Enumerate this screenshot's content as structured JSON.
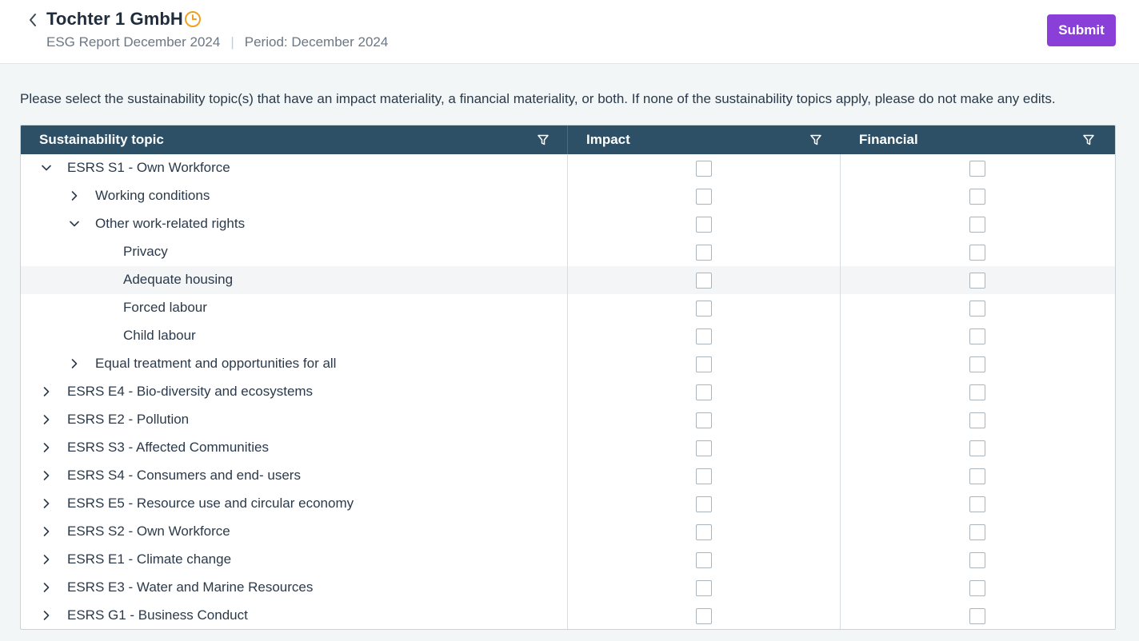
{
  "header": {
    "title": "Tochter 1 GmbH",
    "report": "ESG Report December 2024",
    "separator": "|",
    "period": "Period: December 2024",
    "submit_label": "Submit"
  },
  "instructions": "Please select the sustainability topic(s) that have an impact materiality, a financial materiality, or both. If none of the sustainability topics apply, please do not make any edits.",
  "grid": {
    "columns": [
      "Sustainability topic",
      "Impact",
      "Financial"
    ],
    "rows": [
      {
        "label": "ESRS S1 - Own Workforce",
        "level": 0,
        "expander": "expanded",
        "impact": false,
        "financial": false
      },
      {
        "label": "Working conditions",
        "level": 1,
        "expander": "collapsed",
        "impact": false,
        "financial": false
      },
      {
        "label": "Other work-related rights",
        "level": 1,
        "expander": "expanded",
        "impact": false,
        "financial": false
      },
      {
        "label": "Privacy",
        "level": 2,
        "expander": "none",
        "impact": false,
        "financial": false
      },
      {
        "label": "Adequate housing",
        "level": 2,
        "expander": "none",
        "impact": false,
        "financial": false,
        "highlighted": true
      },
      {
        "label": "Forced labour",
        "level": 2,
        "expander": "none",
        "impact": false,
        "financial": false
      },
      {
        "label": "Child labour",
        "level": 2,
        "expander": "none",
        "impact": false,
        "financial": false
      },
      {
        "label": "Equal treatment and opportunities for all",
        "level": 1,
        "expander": "collapsed",
        "impact": false,
        "financial": false
      },
      {
        "label": "ESRS E4 - Bio-diversity and ecosystems",
        "level": 0,
        "expander": "collapsed",
        "impact": false,
        "financial": false
      },
      {
        "label": "ESRS E2 - Pollution",
        "level": 0,
        "expander": "collapsed",
        "impact": false,
        "financial": false
      },
      {
        "label": "ESRS S3 - Affected Communities",
        "level": 0,
        "expander": "collapsed",
        "impact": false,
        "financial": false
      },
      {
        "label": "ESRS S4 - Consumers and end- users",
        "level": 0,
        "expander": "collapsed",
        "impact": false,
        "financial": false
      },
      {
        "label": "ESRS E5 - Resource use and circular economy",
        "level": 0,
        "expander": "collapsed",
        "impact": false,
        "financial": false
      },
      {
        "label": "ESRS S2 - Own Workforce",
        "level": 0,
        "expander": "collapsed",
        "impact": false,
        "financial": false
      },
      {
        "label": "ESRS E1 - Climate change",
        "level": 0,
        "expander": "collapsed",
        "impact": false,
        "financial": false
      },
      {
        "label": "ESRS E3 - Water and Marine Resources",
        "level": 0,
        "expander": "collapsed",
        "impact": false,
        "financial": false
      },
      {
        "label": "ESRS G1 - Business Conduct",
        "level": 0,
        "expander": "collapsed",
        "impact": false,
        "financial": false
      }
    ]
  },
  "colors": {
    "header_bg": "#2d5066",
    "accent": "#8a3fd9",
    "clock": "#f0a020"
  },
  "icons": {
    "back": "chevron-left-icon",
    "status": "clock-icon",
    "filter": "filter-icon",
    "expanded": "chevron-down-icon",
    "collapsed": "chevron-right-icon"
  }
}
